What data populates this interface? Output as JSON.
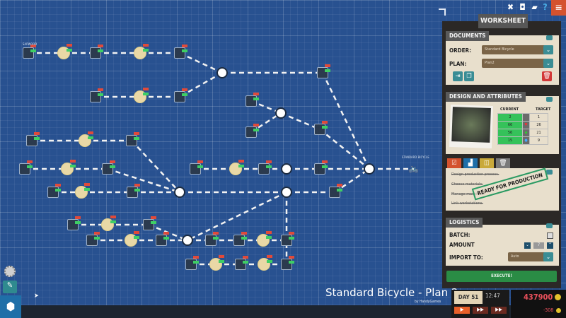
{
  "canvas": {
    "plan_title": "Standard Bicycle - Plan 2",
    "plan_author": "by HandyGames",
    "start_label": "SAPWOOD",
    "product_label": "STANDARD BICYCLE"
  },
  "top_icons": [
    "tools-icon",
    "camera-icon",
    "photo-icon",
    "help-icon",
    "menu-icon"
  ],
  "worksheet": {
    "title": "WORKSHEET",
    "documents": {
      "header": "DOCUMENTS",
      "order_label": "ORDER:",
      "order_value": "Standard Bicycle",
      "plan_label": "PLAN:",
      "plan_value": "Plan2"
    },
    "design": {
      "header": "DESIGN AND ATTRIBUTES",
      "current_label": "CURRENT",
      "target_label": "TARGET",
      "attributes": [
        {
          "icon": "weight-icon",
          "current": "2",
          "target": "1"
        },
        {
          "icon": "heart-icon",
          "current": "66",
          "target": "26"
        },
        {
          "icon": "quality-icon",
          "current": "56",
          "target": "21"
        },
        {
          "icon": "style-icon",
          "current": "15",
          "target": "9"
        }
      ]
    },
    "tasks": {
      "items": [
        "Design production process.",
        "Choose materials.",
        "Manage machines.",
        "Link workstations."
      ],
      "stamp": "READY FOR PRODUCTION"
    },
    "logistics": {
      "header": "LOGISTICS",
      "batch_label": "BATCH:",
      "batch_checked": false,
      "amount_label": "AMOUNT",
      "amount_value": "7",
      "import_label": "IMPORT TO:",
      "import_value": "Auto"
    },
    "execute_label": "EXECUTE!"
  },
  "status": {
    "day": "DAY 51",
    "time": "12:47",
    "money": "437900",
    "income": "-308",
    "colors": {
      "money": "#e8505b",
      "play": "#e8602a"
    }
  }
}
